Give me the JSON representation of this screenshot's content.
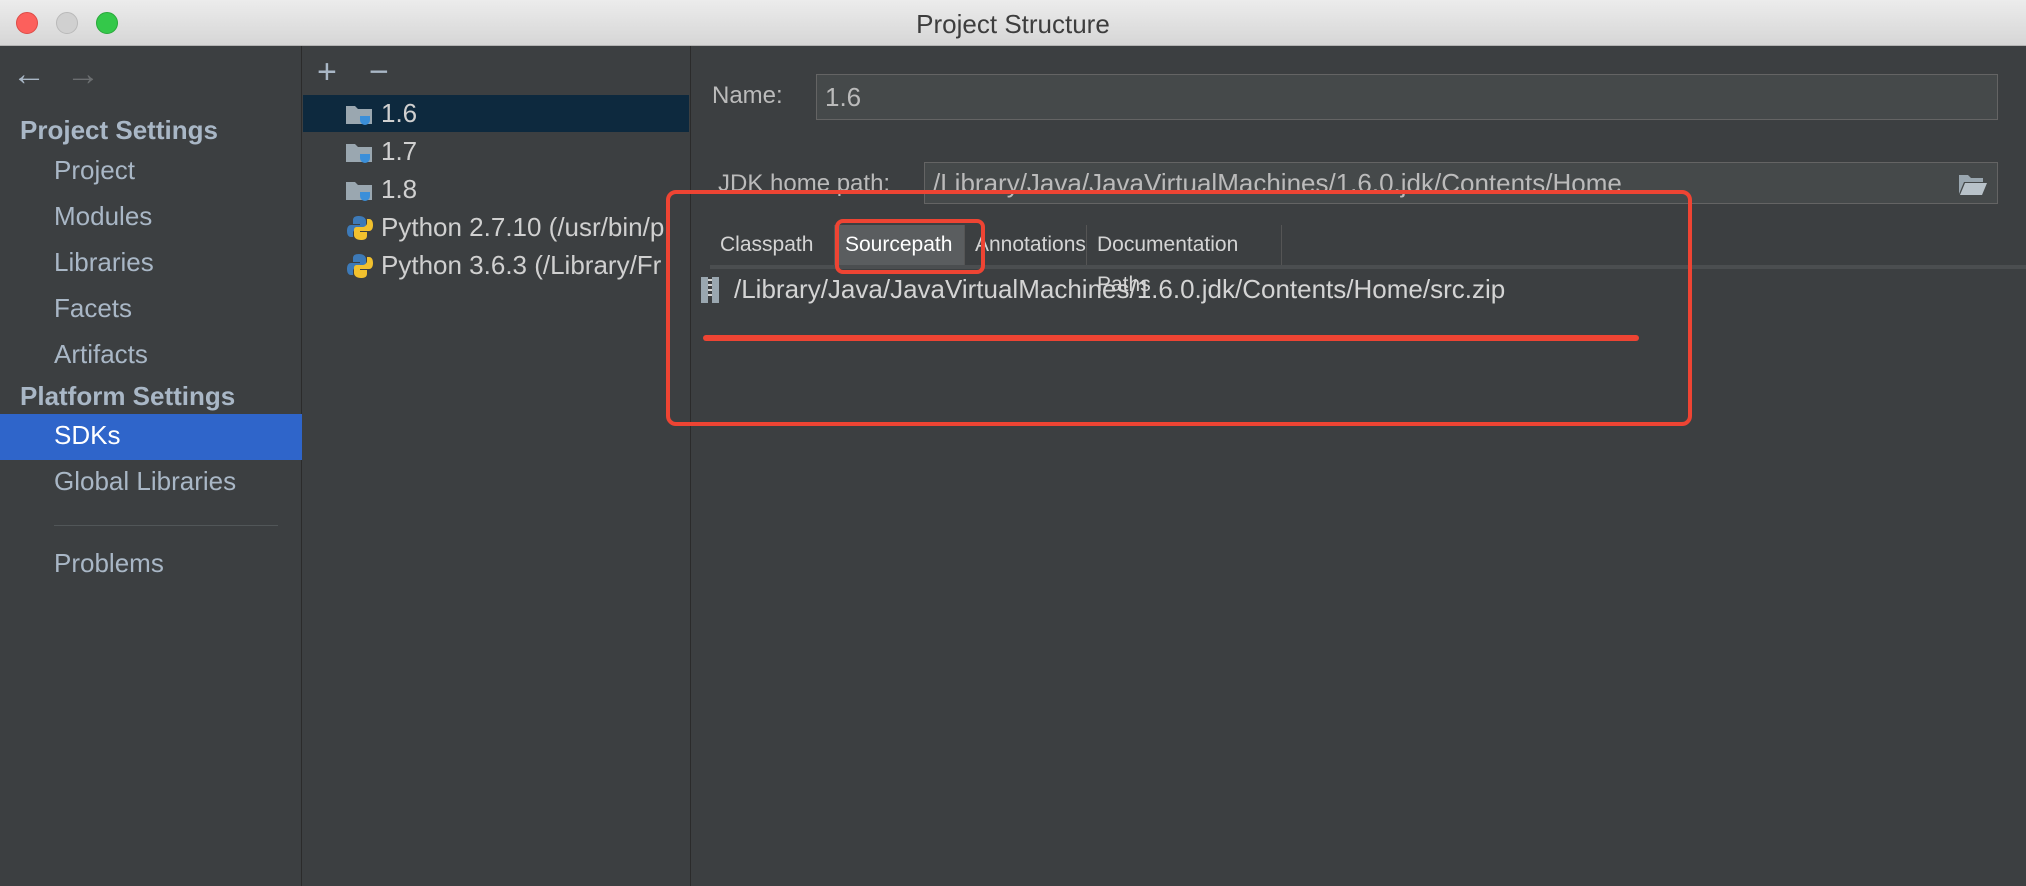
{
  "window": {
    "title": "Project Structure"
  },
  "nav": {
    "back_icon": "back-arrow-icon",
    "forward_icon": "forward-arrow-icon",
    "project_settings": "Project Settings",
    "project_items": [
      "Project",
      "Modules",
      "Libraries",
      "Facets",
      "Artifacts"
    ],
    "platform_settings": "Platform Settings",
    "platform_items": [
      "SDKs",
      "Global Libraries"
    ],
    "selected": "SDKs",
    "problems": "Problems"
  },
  "sdk_list": {
    "add_label": "+",
    "remove_label": "−",
    "items": [
      {
        "label": "1.6",
        "icon": "jdk-folder-icon",
        "selected": true
      },
      {
        "label": "1.7",
        "icon": "jdk-folder-icon"
      },
      {
        "label": "1.8",
        "icon": "jdk-folder-icon"
      },
      {
        "label": "Python 2.7.10 (/usr/bin/p",
        "icon": "python-icon"
      },
      {
        "label": "Python 3.6.3 (/Library/Fr",
        "icon": "python-icon"
      }
    ]
  },
  "details": {
    "name_label": "Name:",
    "name_value": "1.6",
    "jdk_home_label": "JDK home path:",
    "jdk_home_value": "/Library/Java/JavaVirtualMachines/1.6.0.jdk/Contents/Home",
    "browse_icon": "open-folder-icon",
    "tabs": [
      "Classpath",
      "Sourcepath",
      "Annotations",
      "Documentation Paths"
    ],
    "active_tab": "Sourcepath",
    "sourcepath_entries": [
      "/Library/Java/JavaVirtualMachines/1.6.0.jdk/Contents/Home/src.zip"
    ]
  },
  "colors": {
    "background": "#3c3f41",
    "selection_blue": "#2f65ca",
    "list_selection": "#0d293e",
    "annotation_red": "#ee4433"
  }
}
